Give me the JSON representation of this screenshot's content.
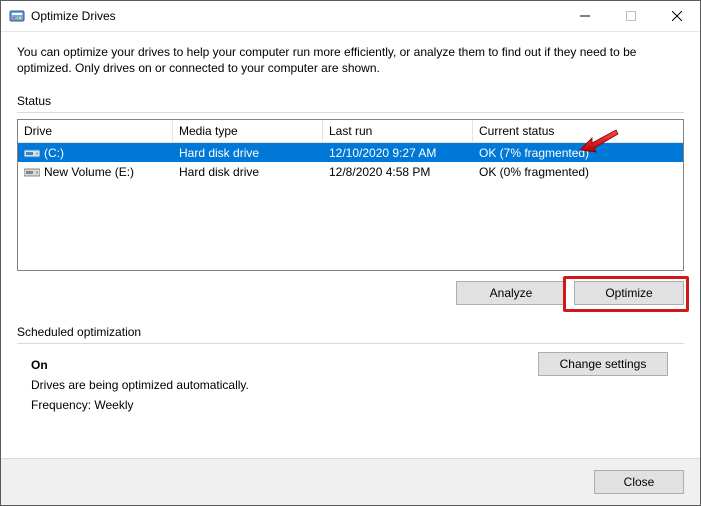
{
  "window": {
    "title": "Optimize Drives"
  },
  "intro": "You can optimize your drives to help your computer run more efficiently, or analyze them to find out if they need to be optimized. Only drives on or connected to your computer are shown.",
  "status_label": "Status",
  "columns": {
    "drive": "Drive",
    "media": "Media type",
    "lastrun": "Last run",
    "status": "Current status"
  },
  "drives": [
    {
      "name": "(C:)",
      "media": "Hard disk drive",
      "lastrun": "12/10/2020 9:27 AM",
      "status": "OK (7% fragmented)",
      "selected": true
    },
    {
      "name": "New Volume (E:)",
      "media": "Hard disk drive",
      "lastrun": "12/8/2020 4:58 PM",
      "status": "OK (0% fragmented)",
      "selected": false
    }
  ],
  "buttons": {
    "analyze": "Analyze",
    "optimize": "Optimize",
    "change_settings": "Change settings",
    "close": "Close"
  },
  "scheduled": {
    "label": "Scheduled optimization",
    "state": "On",
    "desc": "Drives are being optimized automatically.",
    "freq": "Frequency: Weekly"
  }
}
